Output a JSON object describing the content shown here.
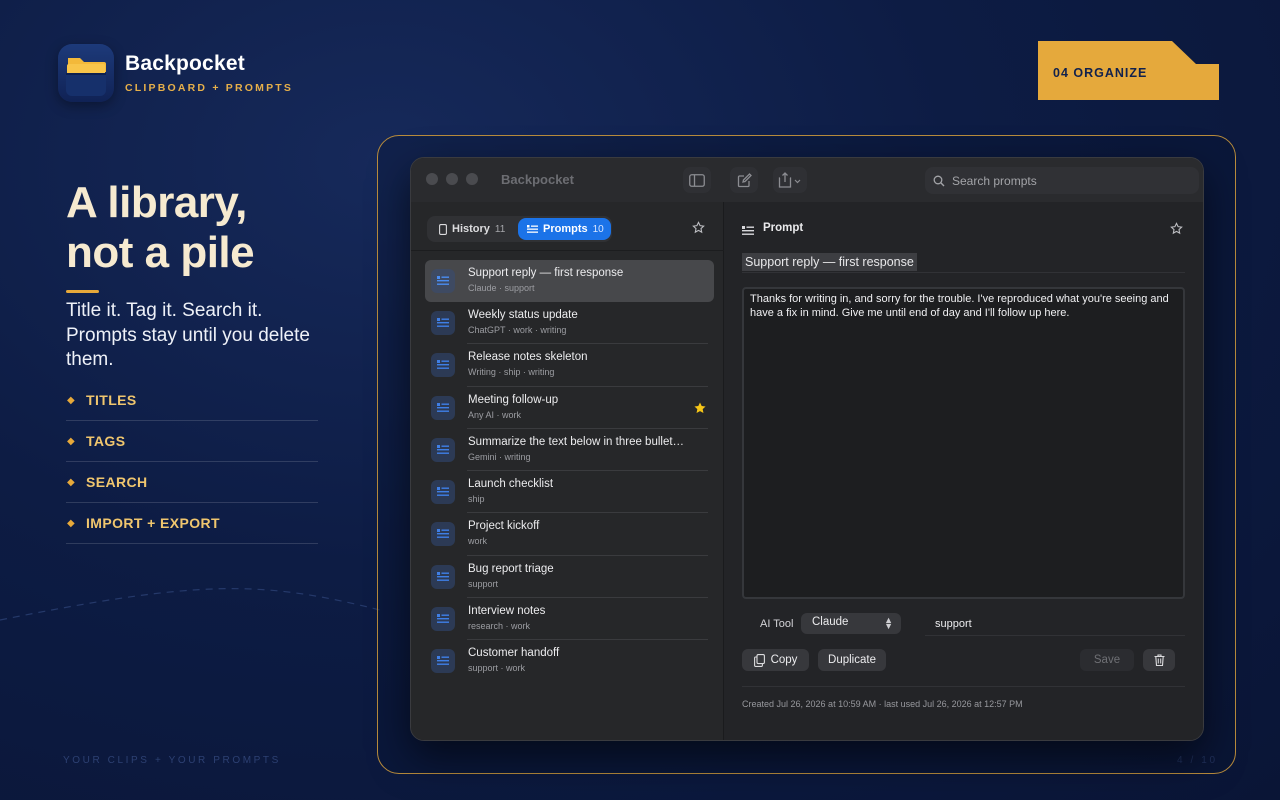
{
  "brand": {
    "name": "Backpocket",
    "tagline": "CLIPBOARD + PROMPTS"
  },
  "badge": {
    "label": "04 ORGANIZE"
  },
  "hero": {
    "headline_line1": "A library,",
    "headline_line2": "not a pile",
    "subcopy": "Title it. Tag it. Search it. Prompts stay until you delete them.",
    "features": [
      "TITLES",
      "TAGS",
      "SEARCH",
      "IMPORT + EXPORT"
    ]
  },
  "footer": {
    "left": "YOUR CLIPS + YOUR PROMPTS",
    "right": "4 / 10"
  },
  "window": {
    "title": "Backpocket",
    "search_placeholder": "Search prompts"
  },
  "sidebar": {
    "tabs": [
      {
        "label": "History",
        "count": "11"
      },
      {
        "label": "Prompts",
        "count": "10"
      }
    ],
    "items": [
      {
        "title": "Support reply — first response",
        "meta": "Claude · support",
        "starred": false
      },
      {
        "title": "Weekly status update",
        "meta": "ChatGPT · work · writing",
        "starred": false
      },
      {
        "title": "Release notes skeleton",
        "meta": "Writing · ship · writing",
        "starred": false
      },
      {
        "title": "Meeting follow-up",
        "meta": "Any AI · work",
        "starred": true
      },
      {
        "title": "Summarize the text below in three bullet…",
        "meta": "Gemini · writing",
        "starred": false
      },
      {
        "title": "Launch checklist",
        "meta": "ship",
        "starred": false
      },
      {
        "title": "Project kickoff",
        "meta": "work",
        "starred": false
      },
      {
        "title": "Bug report triage",
        "meta": "support",
        "starred": false
      },
      {
        "title": "Interview notes",
        "meta": "research · work",
        "starred": false
      },
      {
        "title": "Customer handoff",
        "meta": "support · work",
        "starred": false
      }
    ]
  },
  "detail": {
    "header_label": "Prompt",
    "title": "Support reply — first response",
    "body": "Thanks for writing in, and sorry for the trouble. I've reproduced what you're seeing and have a fix in mind. Give me until end of day and I'll follow up here.",
    "ai_tool_label": "AI Tool",
    "ai_tool_value": "Claude",
    "tags": "support",
    "copy_label": "Copy",
    "duplicate_label": "Duplicate",
    "save_label": "Save",
    "footer": "Created Jul 26, 2026 at 10:59 AM · last used Jul 26, 2026 at 12:57 PM"
  },
  "colors": {
    "accent_gold": "#e7a93a",
    "accent_blue": "#1b73e8",
    "star_yellow": "#f5c518",
    "background_navy": "#0d1c44"
  }
}
